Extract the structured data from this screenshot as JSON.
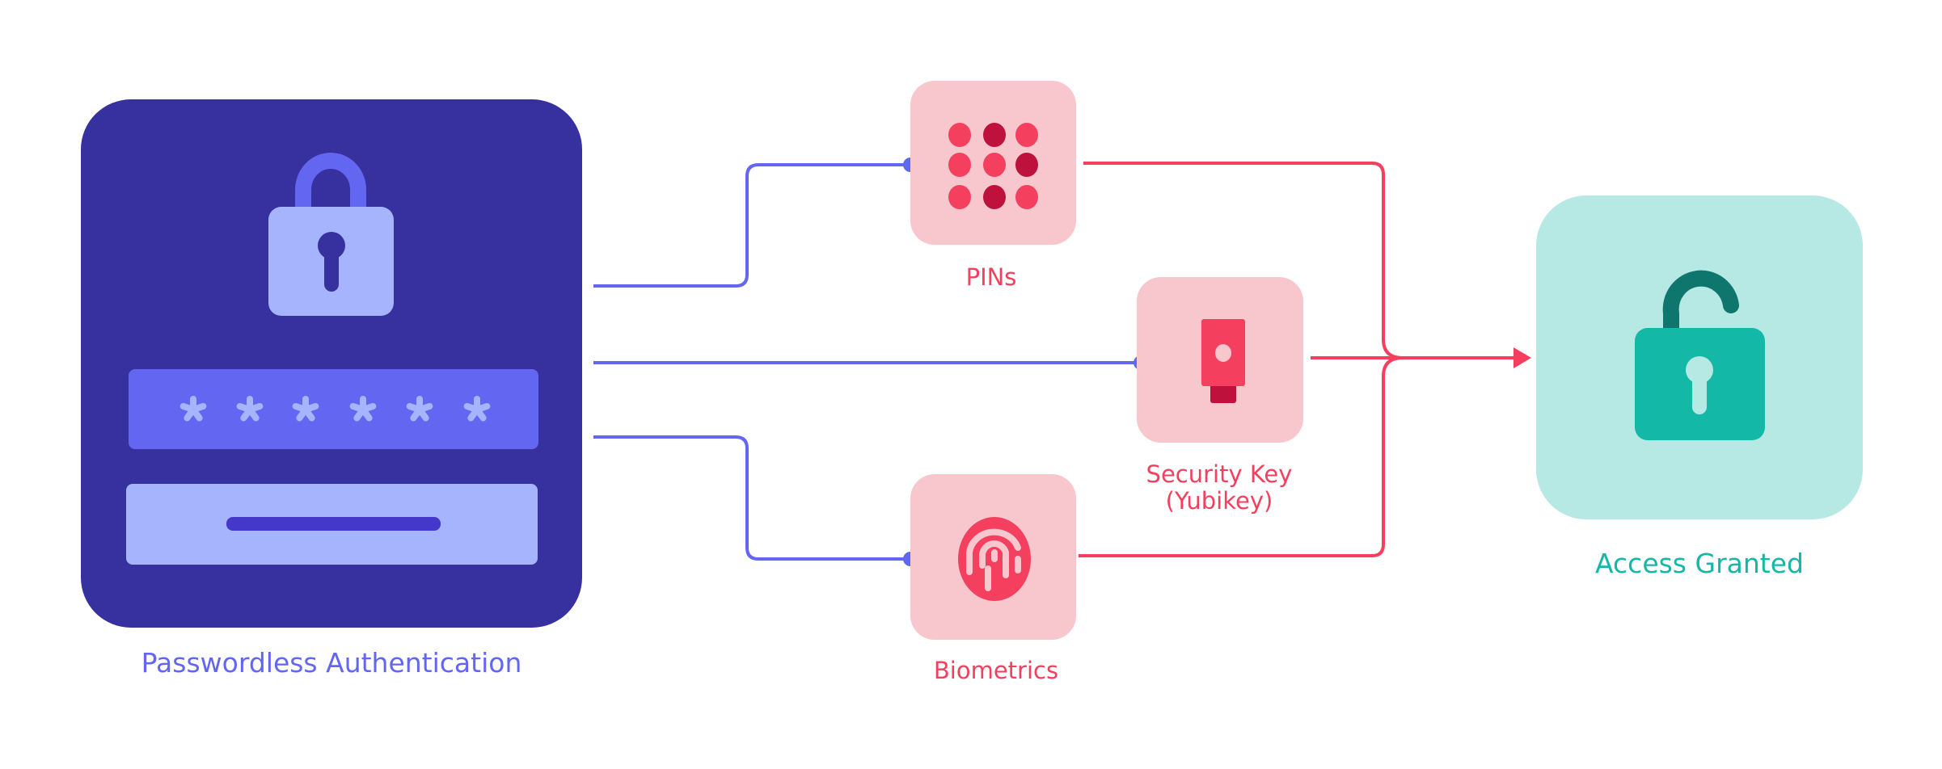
{
  "source": {
    "label": "Passwordless Authentication",
    "icon": "locked-padlock-icon",
    "password_mask": "******",
    "colors": {
      "card": "#37309f",
      "field": "#6366f1",
      "light": "#a5b4fc",
      "bar": "#4338ca"
    }
  },
  "methods": [
    {
      "label": "PINs",
      "icon": "keypad-icon"
    },
    {
      "label_line1": "Security Key",
      "label_line2": "(Yubikey)",
      "icon": "usb-security-key-icon"
    },
    {
      "label": "Biometrics",
      "icon": "fingerprint-icon"
    }
  ],
  "target": {
    "label": "Access Granted",
    "icon": "unlocked-padlock-icon",
    "colors": {
      "card": "#b6e9e3",
      "lock": "#14b8a6",
      "shackle": "#0f766e"
    }
  },
  "colors": {
    "connector_in": "#6366f1",
    "connector_out": "#f43f5e",
    "method_card": "#f8c6cd",
    "method_dark": "#be123c"
  }
}
